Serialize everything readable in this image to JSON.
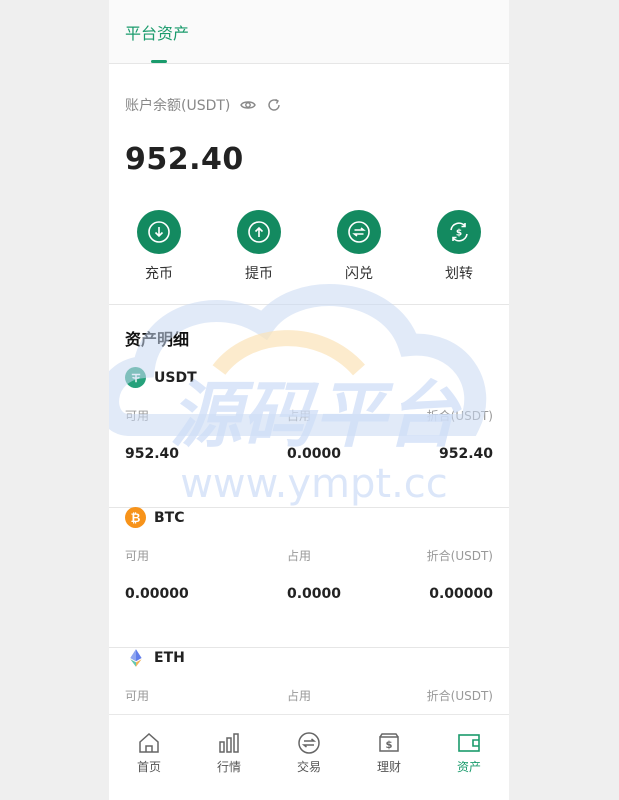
{
  "header": {
    "tab_label": "平台资产"
  },
  "balance": {
    "label": "账户余额(USDT)",
    "amount": "952.40"
  },
  "actions": [
    {
      "label": "充币",
      "icon": "deposit-icon"
    },
    {
      "label": "提币",
      "icon": "withdraw-icon"
    },
    {
      "label": "闪兑",
      "icon": "swap-icon"
    },
    {
      "label": "划转",
      "icon": "transfer-icon"
    }
  ],
  "section": {
    "title": "资产明细"
  },
  "assets": [
    {
      "name": "USDT",
      "available_label": "可用",
      "frozen_label": "占用",
      "equiv_label": "折合(USDT)",
      "available": "952.40",
      "frozen": "0.0000",
      "equiv": "952.40",
      "color": "#26a17b"
    },
    {
      "name": "BTC",
      "available_label": "可用",
      "frozen_label": "占用",
      "equiv_label": "折合(USDT)",
      "available": "0.00000",
      "frozen": "0.0000",
      "equiv": "0.00000",
      "color": "#f7931a"
    },
    {
      "name": "ETH",
      "available_label": "可用",
      "frozen_label": "占用",
      "equiv_label": "折合(USDT)",
      "color": "#627eea"
    }
  ],
  "watermark": {
    "title": "源码平台",
    "url": "www.ympt.cc"
  },
  "nav": [
    {
      "label": "首页",
      "icon": "home-icon"
    },
    {
      "label": "行情",
      "icon": "chart-bar-icon"
    },
    {
      "label": "交易",
      "icon": "trade-icon"
    },
    {
      "label": "理财",
      "icon": "finance-icon"
    },
    {
      "label": "资产",
      "icon": "wallet-icon",
      "active": true
    }
  ],
  "colors": {
    "accent": "#1a9b6c",
    "action_bg": "#138a60"
  }
}
